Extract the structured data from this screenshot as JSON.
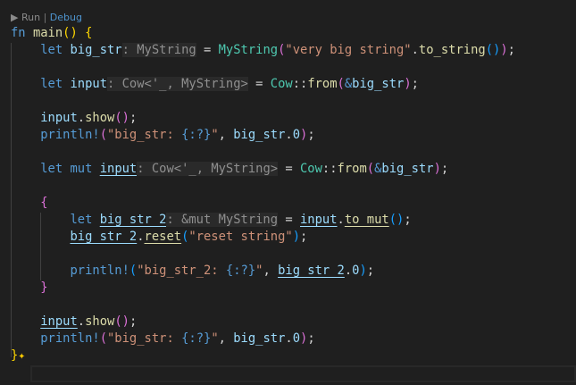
{
  "codelens": {
    "run": "▶ Run",
    "separator": "|",
    "debug": "Debug"
  },
  "code_lines": [
    [
      [
        "fn",
        "k"
      ],
      [
        " ",
        "p"
      ],
      [
        "main",
        "f"
      ],
      [
        "()",
        "b1"
      ],
      [
        " ",
        "p"
      ],
      [
        "{",
        "b1"
      ]
    ],
    [
      [
        "    let",
        "k"
      ],
      [
        " ",
        "p"
      ],
      [
        "big_str",
        "v"
      ],
      [
        ": MyString",
        "h"
      ],
      [
        " = ",
        "p"
      ],
      [
        "MyString",
        "t"
      ],
      [
        "(",
        "b2"
      ],
      [
        "\"very big string\"",
        "s"
      ],
      [
        ".",
        "p"
      ],
      [
        "to_string",
        "f"
      ],
      [
        "()",
        "b3"
      ],
      [
        ")",
        "b2"
      ],
      [
        ";",
        "p"
      ]
    ],
    [],
    [
      [
        "    let",
        "k"
      ],
      [
        " ",
        "p"
      ],
      [
        "input",
        "v"
      ],
      [
        ": Cow<'_, MyString>",
        "h"
      ],
      [
        " = ",
        "p"
      ],
      [
        "Cow",
        "t"
      ],
      [
        "::",
        "p"
      ],
      [
        "from",
        "f"
      ],
      [
        "(",
        "b2"
      ],
      [
        "&",
        "k"
      ],
      [
        "big_str",
        "v"
      ],
      [
        ")",
        "b2"
      ],
      [
        ";",
        "p"
      ]
    ],
    [],
    [
      [
        "    ",
        "p"
      ],
      [
        "input",
        "v"
      ],
      [
        ".",
        "p"
      ],
      [
        "show",
        "f"
      ],
      [
        "()",
        "b2"
      ],
      [
        ";",
        "p"
      ]
    ],
    [
      [
        "    ",
        "p"
      ],
      [
        "println!",
        "m"
      ],
      [
        "(",
        "b2"
      ],
      [
        "\"big_str: ",
        "s"
      ],
      [
        "{:?}",
        "m"
      ],
      [
        "\"",
        "s"
      ],
      [
        ", ",
        "p"
      ],
      [
        "big_str",
        "v"
      ],
      [
        ".",
        "p"
      ],
      [
        "0",
        "v"
      ],
      [
        ")",
        "b2"
      ],
      [
        ";",
        "p"
      ]
    ],
    [],
    [
      [
        "    let",
        "k"
      ],
      [
        " ",
        "p"
      ],
      [
        "mut",
        "k"
      ],
      [
        " ",
        "p"
      ],
      [
        "input",
        "v u"
      ],
      [
        ": Cow<'_, MyString>",
        "h"
      ],
      [
        " = ",
        "p"
      ],
      [
        "Cow",
        "t"
      ],
      [
        "::",
        "p"
      ],
      [
        "from",
        "f"
      ],
      [
        "(",
        "b2"
      ],
      [
        "&",
        "k"
      ],
      [
        "big_str",
        "v"
      ],
      [
        ")",
        "b2"
      ],
      [
        ";",
        "p"
      ]
    ],
    [],
    [
      [
        "    ",
        "p"
      ],
      [
        "{",
        "b2"
      ]
    ],
    [
      [
        "        let",
        "k"
      ],
      [
        " ",
        "p"
      ],
      [
        "big_str_2",
        "v u"
      ],
      [
        ": &mut MyString",
        "h"
      ],
      [
        " = ",
        "p"
      ],
      [
        "input",
        "v u"
      ],
      [
        ".",
        "p"
      ],
      [
        "to_mut",
        "f u"
      ],
      [
        "()",
        "b3"
      ],
      [
        ";",
        "p"
      ]
    ],
    [
      [
        "        ",
        "p"
      ],
      [
        "big_str_2",
        "v u"
      ],
      [
        ".",
        "p"
      ],
      [
        "reset",
        "f u"
      ],
      [
        "(",
        "b3"
      ],
      [
        "\"reset string\"",
        "s"
      ],
      [
        ")",
        "b3"
      ],
      [
        ";",
        "p"
      ]
    ],
    [],
    [
      [
        "        ",
        "p"
      ],
      [
        "println!",
        "m"
      ],
      [
        "(",
        "b3"
      ],
      [
        "\"big_str_2: ",
        "s"
      ],
      [
        "{:?}",
        "m"
      ],
      [
        "\"",
        "s"
      ],
      [
        ", ",
        "p"
      ],
      [
        "big_str_2",
        "v u"
      ],
      [
        ".",
        "p"
      ],
      [
        "0",
        "v"
      ],
      [
        ")",
        "b3"
      ],
      [
        ";",
        "p"
      ]
    ],
    [
      [
        "    ",
        "p"
      ],
      [
        "}",
        "b2"
      ]
    ],
    [],
    [
      [
        "    ",
        "p"
      ],
      [
        "input",
        "v u"
      ],
      [
        ".",
        "p"
      ],
      [
        "show",
        "f"
      ],
      [
        "()",
        "b2"
      ],
      [
        ";",
        "p"
      ]
    ],
    [
      [
        "    ",
        "p"
      ],
      [
        "println!",
        "m"
      ],
      [
        "(",
        "b2"
      ],
      [
        "\"big_str: ",
        "s"
      ],
      [
        "{:?}",
        "m"
      ],
      [
        "\"",
        "s"
      ],
      [
        ", ",
        "p"
      ],
      [
        "big_str",
        "v"
      ],
      [
        ".",
        "p"
      ],
      [
        "0",
        "v"
      ],
      [
        ")",
        "b2"
      ],
      [
        ";",
        "p"
      ]
    ],
    [
      [
        "}",
        "b1"
      ]
    ]
  ],
  "sparkle_icon": "sparkle-icon",
  "colors": {
    "background": "#1f1f1f",
    "keyword": "#569cd6",
    "variable": "#9cdcfe",
    "type": "#4ec9b0",
    "string": "#ce9178",
    "function": "#dcdcaa"
  }
}
